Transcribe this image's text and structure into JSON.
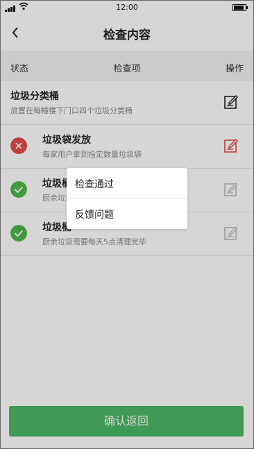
{
  "status_bar": {
    "time": "12:00"
  },
  "nav": {
    "title": "检查内容"
  },
  "header": {
    "status": "状态",
    "item": "检查项",
    "operation": "操作"
  },
  "rows": [
    {
      "name": "垃圾分类桶",
      "desc": "放置在每幢楼下门口四个垃圾分类桶",
      "status": "none",
      "edit_color": "#222222"
    },
    {
      "name": "垃圾袋发放",
      "desc": "每家用户拿到指定数量垃圾袋",
      "status": "fail",
      "edit_color": "#e44a4a"
    },
    {
      "name": "垃圾桶",
      "desc": "厨余垃圾",
      "status": "pass",
      "edit_color": "#bbbbbb"
    },
    {
      "name": "垃圾桶",
      "desc": "厨余垃圾需要每天5点清理完毕",
      "status": "pass",
      "edit_color": "#bbbbbb"
    }
  ],
  "popup": {
    "option1": "检查通过",
    "option2": "反馈问题"
  },
  "footer": {
    "confirm_label": "确认返回"
  },
  "colors": {
    "accent": "#4cb866",
    "fail": "#e44a4a",
    "pass": "#4cb848"
  }
}
